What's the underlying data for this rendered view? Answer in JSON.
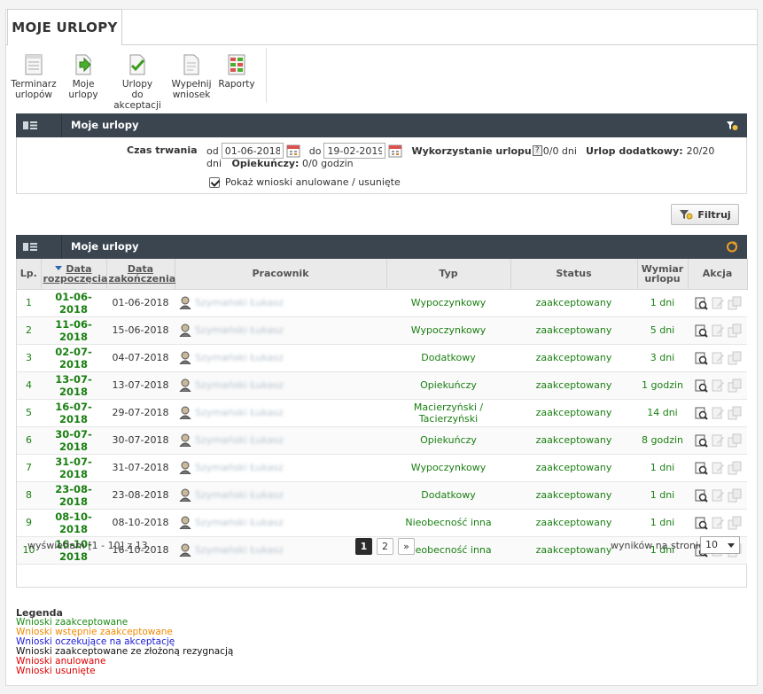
{
  "tab": {
    "title": "MOJE URLOPY"
  },
  "toolbar": [
    {
      "line1": "Terminarz",
      "line2": "urlopów",
      "icon": "calendar-list-icon"
    },
    {
      "line1": "Moje",
      "line2": "urlopy",
      "icon": "arrow-document-icon"
    },
    {
      "line1": "Urlopy",
      "line2": "do akceptacji",
      "icon": "check-document-icon"
    },
    {
      "line1": "Wypełnij",
      "line2": "wniosek",
      "icon": "edit-document-icon"
    },
    {
      "line1": "Raporty",
      "line2": "",
      "icon": "report-icon"
    }
  ],
  "filter_panel": {
    "title": "Moje urlopy",
    "duration_label": "Czas trwania",
    "from_label": "od",
    "from_value": "01-06-2018",
    "to_label": "do",
    "to_value": "19-02-2019",
    "usage_label": "Wykorzystanie urlopu",
    "usage_value": "0/0 dni",
    "extra_label": "Urlop dodatkowy:",
    "extra_value": "20/20",
    "extra_unit": "dni",
    "care_label": "Opiekuńczy:",
    "care_value": "0/0 godzin",
    "show_cancelled_label": "Pokaż wnioski anulowane / usunięte",
    "show_cancelled_checked": true,
    "filter_button": "Filtruj"
  },
  "table_panel": {
    "title": "Moje urlopy",
    "columns": {
      "lp": "Lp.",
      "start_1": "Data",
      "start_2": "rozpoczęcia",
      "end_1": "Data",
      "end_2": "zakończenia",
      "employee": "Pracownik",
      "type": "Typ",
      "status": "Status",
      "dur_1": "Wymiar",
      "dur_2": "urlopu",
      "action": "Akcja"
    },
    "rows": [
      {
        "lp": "1",
        "start": "01-06-2018",
        "end": "01-06-2018",
        "employee": "Szymański Łukasz",
        "type": "Wypoczynkowy",
        "status": "zaakceptowany",
        "duration": "1 dni"
      },
      {
        "lp": "2",
        "start": "11-06-2018",
        "end": "15-06-2018",
        "employee": "Szymański Łukasz",
        "type": "Wypoczynkowy",
        "status": "zaakceptowany",
        "duration": "5 dni"
      },
      {
        "lp": "3",
        "start": "02-07-2018",
        "end": "04-07-2018",
        "employee": "Szymański Łukasz",
        "type": "Dodatkowy",
        "status": "zaakceptowany",
        "duration": "3 dni"
      },
      {
        "lp": "4",
        "start": "13-07-2018",
        "end": "13-07-2018",
        "employee": "Szymański Łukasz",
        "type": "Opiekuńczy",
        "status": "zaakceptowany",
        "duration": "1 godzin"
      },
      {
        "lp": "5",
        "start": "16-07-2018",
        "end": "29-07-2018",
        "employee": "Szymański Łukasz",
        "type": "Macierzyński / Tacierzyński",
        "status": "zaakceptowany",
        "duration": "14 dni"
      },
      {
        "lp": "6",
        "start": "30-07-2018",
        "end": "30-07-2018",
        "employee": "Szymański Łukasz",
        "type": "Opiekuńczy",
        "status": "zaakceptowany",
        "duration": "8 godzin"
      },
      {
        "lp": "7",
        "start": "31-07-2018",
        "end": "31-07-2018",
        "employee": "Szymański Łukasz",
        "type": "Wypoczynkowy",
        "status": "zaakceptowany",
        "duration": "1 dni"
      },
      {
        "lp": "8",
        "start": "23-08-2018",
        "end": "23-08-2018",
        "employee": "Szymański Łukasz",
        "type": "Dodatkowy",
        "status": "zaakceptowany",
        "duration": "1 dni"
      },
      {
        "lp": "9",
        "start": "08-10-2018",
        "end": "08-10-2018",
        "employee": "Szymański Łukasz",
        "type": "Nieobecność inna",
        "status": "zaakceptowany",
        "duration": "1 dni"
      },
      {
        "lp": "10",
        "start": "16-10-2018",
        "end": "16-10-2018",
        "employee": "Szymański Łukasz",
        "type": "Nieobecność inna",
        "status": "zaakceptowany",
        "duration": "1 dni"
      }
    ]
  },
  "pagination": {
    "info": "wyświetlam [1 - 10] z 13",
    "pages": [
      "1",
      "2"
    ],
    "next": "»",
    "per_page_label": "wyników na stronie:",
    "per_page_value": "10"
  },
  "legend": {
    "title": "Legenda",
    "items": [
      {
        "label": "Wnioski zaakceptowane",
        "color": "#1a8a12"
      },
      {
        "label": "Wnioski wstępnie zaakceptowane",
        "color": "#f08a00"
      },
      {
        "label": "Wnioski oczekujące na akceptację",
        "color": "#1b1bd6"
      },
      {
        "label": "Wnioski zaakceptowane ze złożoną rezygnacją",
        "color": "#111111"
      },
      {
        "label": "Wnioski anulowane",
        "color": "#e00000"
      },
      {
        "label": "Wnioski usunięte",
        "color": "#e00000"
      }
    ]
  },
  "colors": {
    "header_bg": "#3a4550",
    "accent_green": "#1a7f12"
  }
}
